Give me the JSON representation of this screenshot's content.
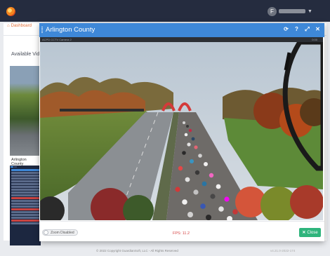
{
  "topnav": {
    "user_initial": "F"
  },
  "dashboard": {
    "breadcrumb_label": "Dashboard",
    "section_title": "Available Vide",
    "thumb_label": "Arlington County",
    "side_tabs": [
      "",
      ""
    ]
  },
  "modal": {
    "title": "Arlington County",
    "camera_label": "ACPD CCTV Camera 2",
    "camera_time": "0:00",
    "zoom_label": "Zoom Disabled",
    "fps_text": "FPS: 11.2",
    "close_label": "Close",
    "header_icons": [
      "refresh-icon",
      "help-icon",
      "expand-icon",
      "close-icon"
    ]
  },
  "footer": {
    "copyright": "© 2022 Copyright GuardianSoft, LLC - All Rights Reserved",
    "version": "v4.21.0-2022-174"
  },
  "colors": {
    "navbar": "#252c3f",
    "modal_header": "#3e88d8",
    "close_button": "#2fb47c",
    "fps_text": "#d64545",
    "breadcrumb": "#e2703a"
  }
}
